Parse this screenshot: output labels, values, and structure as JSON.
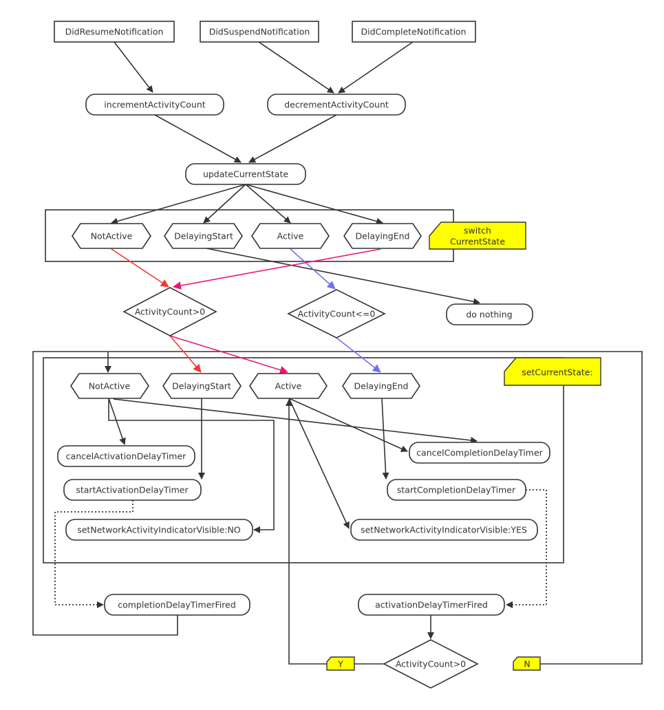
{
  "colors": {
    "line": "#333333",
    "red": "#f03a2e",
    "pink": "#f0147a",
    "blue": "#6f6ff0",
    "note": "#ffff00"
  },
  "notifications": [
    "DidResumeNotification",
    "DidSuspendNotification",
    "DidCompleteNotification"
  ],
  "count_methods": [
    "incrementActivityCount",
    "decrementActivityCount"
  ],
  "update": "updateCurrentState",
  "switch_states": [
    "NotActive",
    "DelayingStart",
    "Active",
    "DelayingEnd"
  ],
  "switch_note": [
    "switch",
    "CurrentState"
  ],
  "decisions": {
    "gt0": "ActivityCount>0",
    "le0": "ActivityCount<=0",
    "bottom": "ActivityCount>0"
  },
  "do_nothing": "do nothing",
  "set_note": "setCurrentState:",
  "set_states": [
    "NotActive",
    "DelayingStart",
    "Active",
    "DelayingEnd"
  ],
  "actions": {
    "cancel_activation": "cancelActivationDelayTimer",
    "start_activation": "startActivationDelayTimer",
    "indicator_no": "setNetworkActivityIndicatorVisible:NO",
    "cancel_completion": "cancelCompletionDelayTimer",
    "start_completion": "startCompletionDelayTimer",
    "indicator_yes": "setNetworkActivityIndicatorVisible:YES",
    "completion_fired": "completionDelayTimerFired",
    "activation_fired": "activationDelayTimerFired"
  },
  "branches": {
    "yes": "Y",
    "no": "N"
  }
}
